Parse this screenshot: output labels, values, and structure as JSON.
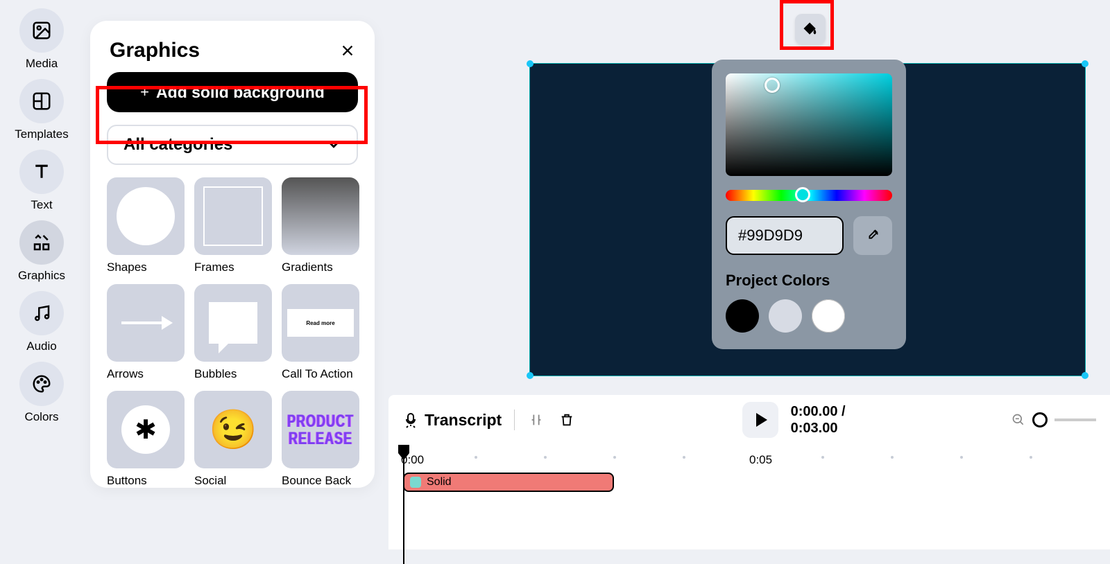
{
  "nav": [
    {
      "label": "Media",
      "icon": "image-icon"
    },
    {
      "label": "Templates",
      "icon": "layout-icon"
    },
    {
      "label": "Text",
      "icon": "text-icon"
    },
    {
      "label": "Graphics",
      "icon": "graphics-icon",
      "selected": true
    },
    {
      "label": "Audio",
      "icon": "audio-icon"
    },
    {
      "label": "Colors",
      "icon": "palette-icon"
    }
  ],
  "panel": {
    "title": "Graphics",
    "add_bg_label": "Add solid background",
    "categories_label": "All categories",
    "tiles": [
      {
        "label": "Shapes"
      },
      {
        "label": "Frames"
      },
      {
        "label": "Gradients"
      },
      {
        "label": "Arrows"
      },
      {
        "label": "Bubbles"
      },
      {
        "label": "Call To Action",
        "cta_text": "Read more"
      },
      {
        "label": "Buttons"
      },
      {
        "label": "Social",
        "emoji": "😉"
      },
      {
        "label": "Bounce Back",
        "bounce_line1": "PRODUCT",
        "bounce_line2": "RELEASE"
      }
    ]
  },
  "picker": {
    "hex": "#99D9D9",
    "project_colors_label": "Project Colors"
  },
  "timeline": {
    "transcript_label": "Transcript",
    "time_current": "0:00.00 /",
    "time_total": "0:03.00",
    "ruler": {
      "t0": "0:00",
      "t5": "0:05"
    },
    "clip_label": "Solid"
  }
}
